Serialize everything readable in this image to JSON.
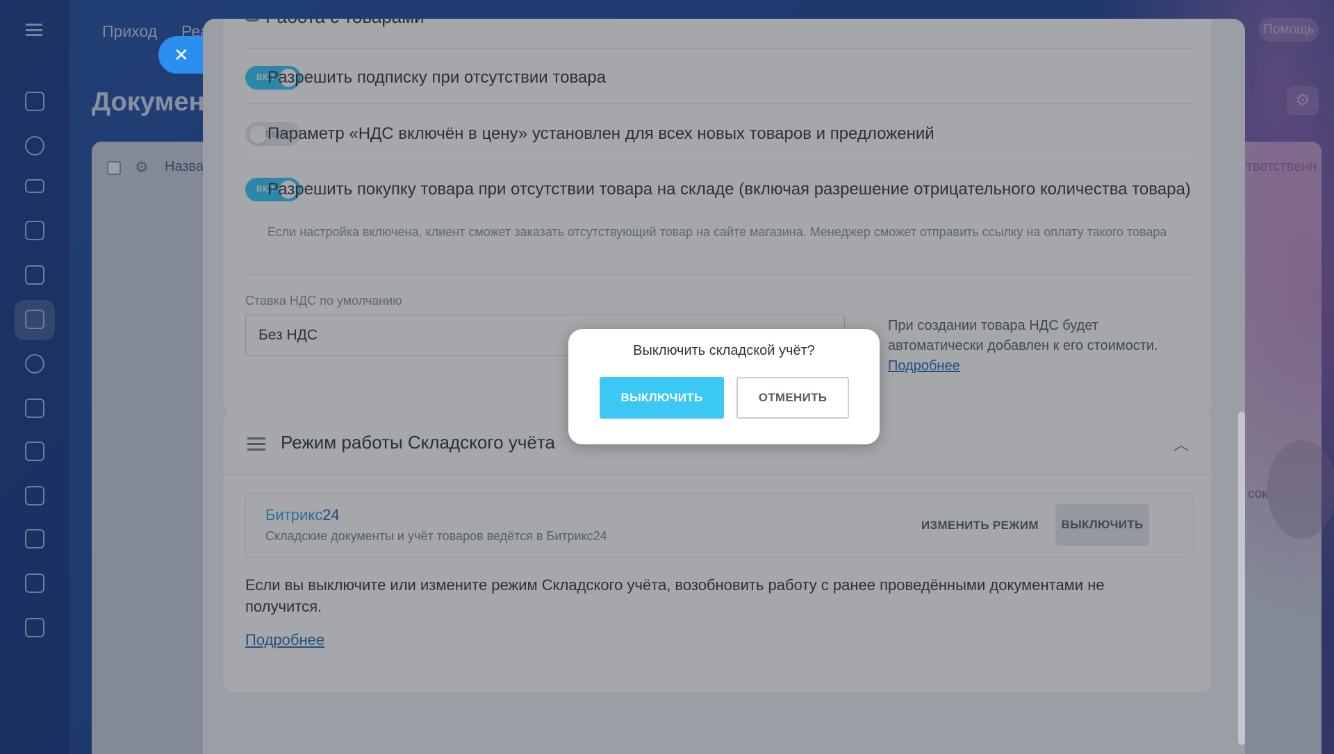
{
  "background": {
    "top_tabs": [
      "Приход",
      "Реа"
    ],
    "help_label": "Помощь",
    "page_title": "Документ",
    "grid_head_name": "Назва",
    "grid_head_responsible": "Ответственн",
    "grid_partial_text": "сок"
  },
  "slider": {
    "section_top_title": "Работа с товарами",
    "settings": [
      {
        "toggle": "ВКЛ",
        "state": "on",
        "label": "Разрешить подписку при отсутствии товара"
      },
      {
        "toggle": "ВЫКЛ",
        "state": "off",
        "label": "Параметр «НДС включён в цену» установлен для всех новых товаров и предложений"
      },
      {
        "toggle": "ВКЛ",
        "state": "on",
        "label": "Разрешить покупку товара при отсутствии товара на складе (включая разрешение отрицательного количества товара)",
        "hint": "Если настройка включена, клиент сможет заказать отсутствующий товар на сайте магазина. Менеджер сможет отправить ссылку на оплату такого товара"
      }
    ],
    "vat": {
      "label": "Ставка НДС по умолчанию",
      "value": "Без НДС",
      "note": "При создании товара НДС будет автоматически добавлен к его стоимости.",
      "more_link": "Подробнее"
    },
    "mode": {
      "title": "Режим работы Складского учёта",
      "name_prefix": "Битрикс",
      "name_suffix": "24",
      "description": "Складские документы и учёт товаров ведётся в Битрикс24",
      "change_button": "ИЗМЕНИТЬ РЕЖИМ",
      "off_button": "ВЫКЛЮЧИТЬ",
      "warning": "Если вы выключите или измените режим Складского учёта, возобновить работу с ранее проведёнными документами не получится.",
      "more_link": "Подробнее"
    }
  },
  "popup": {
    "title": "Выключить складской учёт?",
    "confirm": "ВЫКЛЮЧИТЬ",
    "cancel": "ОТМЕНИТЬ"
  },
  "colors": {
    "accent": "#3bc8f5",
    "toggle_on": "#2fc6f6",
    "link": "#2067b0"
  }
}
